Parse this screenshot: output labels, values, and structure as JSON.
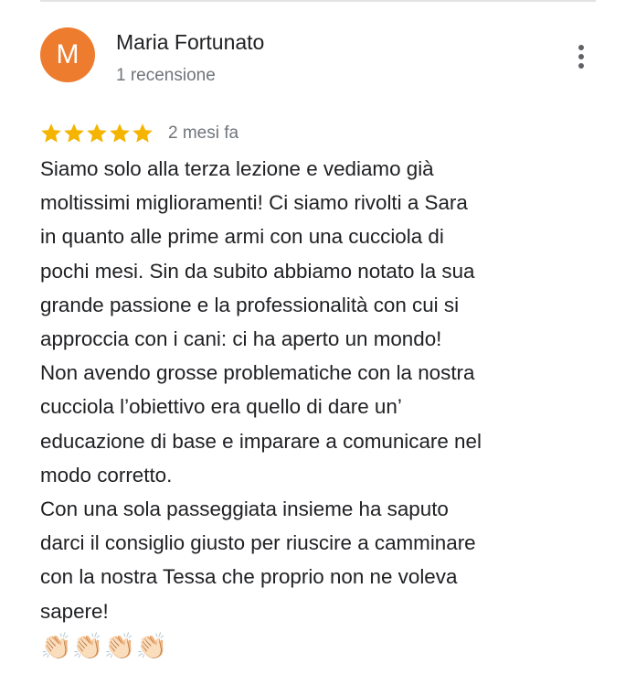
{
  "reviewer": {
    "avatar_letter": "M",
    "avatar_color": "#ee7c2f",
    "name": "Maria Fortunato",
    "meta": "1 recensione"
  },
  "more_menu_icon": "more-vert-icon",
  "review": {
    "rating": 5,
    "rating_max": 5,
    "star_color": "#f4b400",
    "date": "2 mesi fa",
    "lines": [
      "Siamo solo alla terza lezione e vediamo già",
      "moltissimi miglioramenti! Ci siamo rivolti a Sara",
      "in quanto alle prime armi con una cucciola di",
      "pochi mesi. Sin da subito abbiamo notato la sua",
      "grande passione e la professionalità con cui si",
      "approccia con i cani: ci ha aperto un mondo!",
      "Non avendo grosse problematiche con la nostra",
      "cucciola l’obiettivo era quello di dare un’",
      "educazione di base e imparare a comunicare nel",
      "modo corretto.",
      "Con una sola passeggiata insieme ha saputo",
      "darci il consiglio giusto per riuscire a camminare",
      "con la nostra Tessa che proprio non ne voleva",
      "sapere!"
    ],
    "emoji": "👏🏻👏🏻👏🏻👏🏻"
  }
}
